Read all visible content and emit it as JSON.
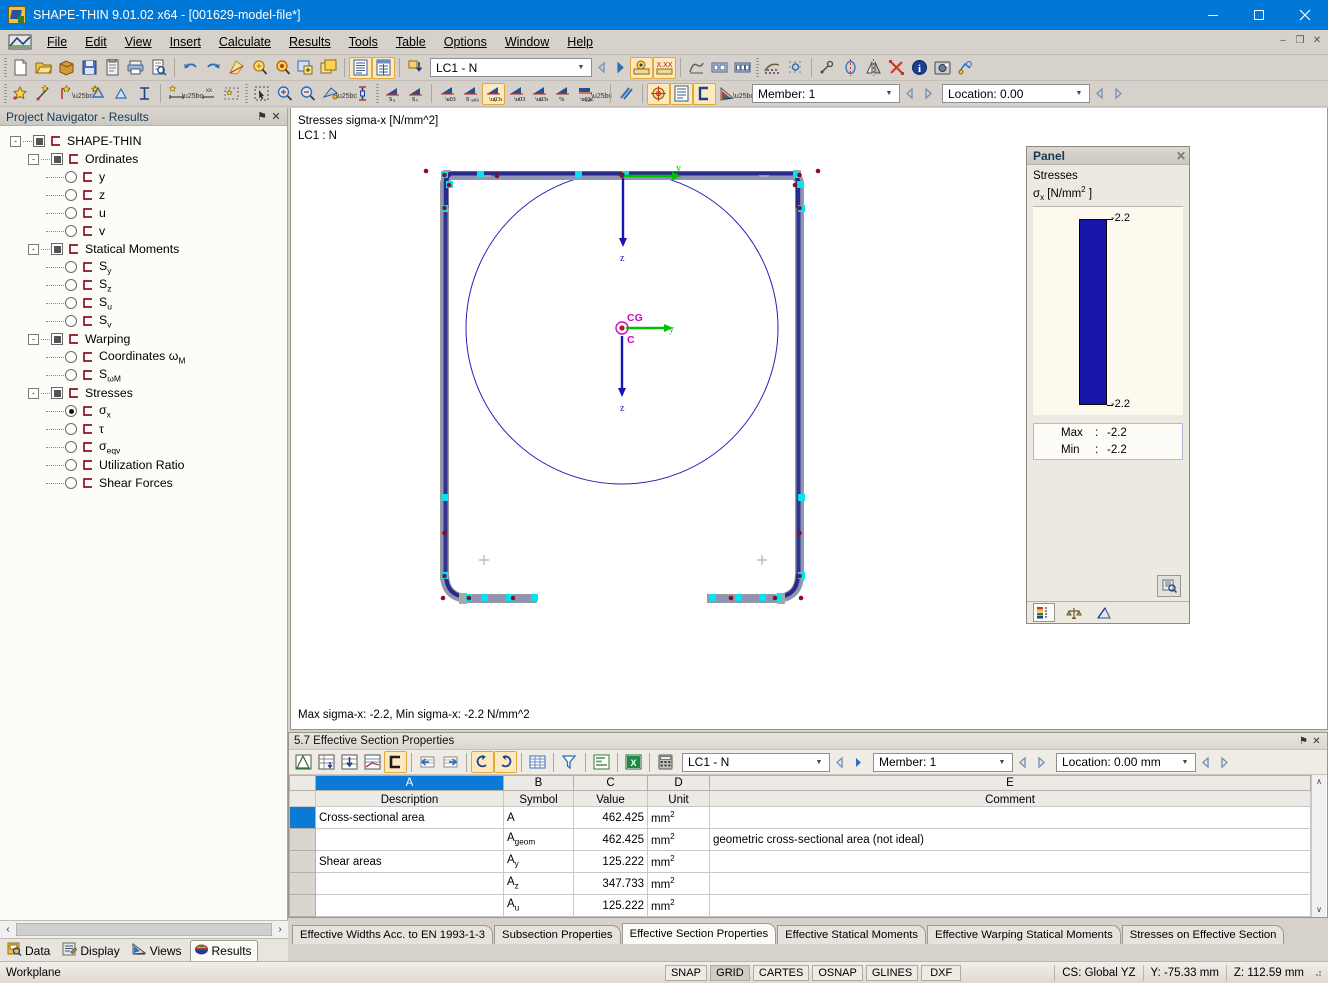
{
  "window": {
    "title": "SHAPE-THIN 9.01.02 x64 - [001629-model-file*]",
    "minimize": "–",
    "maximize": "□",
    "close": "✕"
  },
  "menubar": {
    "items": [
      {
        "label": "File"
      },
      {
        "label": "Edit"
      },
      {
        "label": "View"
      },
      {
        "label": "Insert"
      },
      {
        "label": "Calculate"
      },
      {
        "label": "Results"
      },
      {
        "label": "Tools"
      },
      {
        "label": "Table"
      },
      {
        "label": "Options"
      },
      {
        "label": "Window"
      },
      {
        "label": "Help"
      }
    ],
    "mdi_minimize": "–",
    "mdi_restore": "❐",
    "mdi_close": "✕"
  },
  "toolbar1": {
    "loadcase_value": "LC1 - N",
    "dropdown_arrow": "▼",
    "prev_arrow": "◁",
    "next_arrow": "▷"
  },
  "toolbar2": {
    "member_value": "Member: 1",
    "location_value": "Location: 0.00",
    "dropdown_arrow": "▼",
    "prev_arrow": "◁",
    "next_arrow": "▷"
  },
  "navigator": {
    "title": "Project Navigator - Results",
    "pin": "⚑",
    "close": "✕",
    "tree": [
      {
        "level": 0,
        "type": "check",
        "label": "SHAPE-THIN",
        "expander": "-",
        "checked": true
      },
      {
        "level": 1,
        "type": "check",
        "label": "Ordinates",
        "expander": "-",
        "checked": true
      },
      {
        "level": 2,
        "type": "radio",
        "label": "y",
        "selected": false
      },
      {
        "level": 2,
        "type": "radio",
        "label": "z",
        "selected": false
      },
      {
        "level": 2,
        "type": "radio",
        "label": "u",
        "selected": false
      },
      {
        "level": 2,
        "type": "radio",
        "label": "v",
        "selected": false
      },
      {
        "level": 1,
        "type": "check",
        "label": "Statical Moments",
        "expander": "-",
        "checked": true
      },
      {
        "level": 2,
        "type": "radio",
        "label": "S",
        "sub": "y",
        "selected": false
      },
      {
        "level": 2,
        "type": "radio",
        "label": "S",
        "sub": "z",
        "selected": false
      },
      {
        "level": 2,
        "type": "radio",
        "label": "S",
        "sub": "u",
        "selected": false
      },
      {
        "level": 2,
        "type": "radio",
        "label": "S",
        "sub": "v",
        "selected": false
      },
      {
        "level": 1,
        "type": "check",
        "label": "Warping",
        "expander": "-",
        "checked": true
      },
      {
        "level": 2,
        "type": "radio",
        "label": "Coordinates ω",
        "sub": "M",
        "selected": false
      },
      {
        "level": 2,
        "type": "radio",
        "label": "S",
        "sub": "ωM",
        "selected": false
      },
      {
        "level": 1,
        "type": "check",
        "label": "Stresses",
        "expander": "-",
        "checked": true
      },
      {
        "level": 2,
        "type": "radio",
        "label": "σ",
        "sub": "x",
        "selected": true
      },
      {
        "level": 2,
        "type": "radio",
        "label": "τ",
        "selected": false
      },
      {
        "level": 2,
        "type": "radio",
        "label": "σ",
        "sub": "eqv",
        "selected": false
      },
      {
        "level": 2,
        "type": "radio",
        "label": "Utilization Ratio",
        "selected": false
      },
      {
        "level": 2,
        "type": "radio",
        "label": "Shear Forces",
        "selected": false
      }
    ]
  },
  "drawing": {
    "caption_line1": "Stresses sigma-x [N/mm^2]",
    "caption_line2": "LC1 : N",
    "status_text": "Max sigma-x: -2.2, Min sigma-x: -2.2 N/mm^2",
    "axis_labels": {
      "top_y": "y",
      "top_z": "z",
      "cg": "CG",
      "c": "C",
      "center_y": "y",
      "center_z": "z"
    }
  },
  "panel": {
    "title": "Panel",
    "close": "✕",
    "heading": "Stresses",
    "quantity": "σ",
    "quantity_sub": "x",
    "unit": " [N/mm",
    "unit_sup": "2",
    "unit_end": " ]",
    "legend_top": "-2.2",
    "legend_bottom": "-2.2",
    "legend_color": "#1616a8",
    "max_label": "Max",
    "max_colon": ":",
    "max_value": "-2.2",
    "min_label": "Min",
    "min_colon": ":",
    "min_value": "-2.2"
  },
  "table_window": {
    "title": "5.7 Effective Section Properties",
    "pin": "⚑",
    "close": "✕",
    "loadcase_value": "LC1 - N",
    "member_value": "Member: 1",
    "location_value": "Location: 0.00 mm",
    "dropdown_arrow": "▼",
    "prev_arrow": "◁",
    "next_arrow": "▷",
    "column_letters": [
      "A",
      "B",
      "C",
      "D",
      "E"
    ],
    "headers": [
      "Description",
      "Symbol",
      "Value",
      "Unit",
      "Comment"
    ],
    "rows": [
      {
        "description": "Cross-sectional area",
        "symbol": "A",
        "symbol_sub": "",
        "value": "462.425",
        "unit": "mm",
        "unit_sup": "2",
        "comment": "",
        "selected": true
      },
      {
        "description": "",
        "symbol": "A",
        "symbol_sub": "geom",
        "value": "462.425",
        "unit": "mm",
        "unit_sup": "2",
        "comment": "geometric cross-sectional area (not ideal)",
        "selected": false
      },
      {
        "description": "Shear areas",
        "symbol": "A",
        "symbol_sub": "y",
        "value": "125.222",
        "unit": "mm",
        "unit_sup": "2",
        "comment": "",
        "selected": false
      },
      {
        "description": "",
        "symbol": "A",
        "symbol_sub": "z",
        "value": "347.733",
        "unit": "mm",
        "unit_sup": "2",
        "comment": "",
        "selected": false
      },
      {
        "description": "",
        "symbol": "A",
        "symbol_sub": "u",
        "value": "125.222",
        "unit": "mm",
        "unit_sup": "2",
        "comment": "",
        "selected": false
      }
    ],
    "scroll_up": "∧",
    "scroll_down": "∨"
  },
  "table_tabs": [
    {
      "label": "Effective Widths Acc. to EN 1993-1-3",
      "active": false
    },
    {
      "label": "Subsection Properties",
      "active": false
    },
    {
      "label": "Effective Section Properties",
      "active": true
    },
    {
      "label": "Effective Statical Moments",
      "active": false
    },
    {
      "label": "Effective Warping Statical Moments",
      "active": false
    },
    {
      "label": "Stresses on Effective Section",
      "active": false
    }
  ],
  "navigator_tabs": [
    {
      "label": "Data",
      "icon": "data-icon",
      "active": false
    },
    {
      "label": "Display",
      "icon": "display-icon",
      "active": false
    },
    {
      "label": "Views",
      "icon": "views-icon",
      "active": false
    },
    {
      "label": "Results",
      "icon": "results-icon",
      "active": true
    }
  ],
  "navigator_scroll": {
    "left": "‹",
    "right": "›"
  },
  "statusbar": {
    "workplane": "Workplane",
    "chips": [
      {
        "label": "SNAP",
        "on": false
      },
      {
        "label": "GRID",
        "on": true
      },
      {
        "label": "CARTES",
        "on": false
      },
      {
        "label": "OSNAP",
        "on": false
      },
      {
        "label": "GLINES",
        "on": false
      },
      {
        "label": "DXF",
        "on": false
      }
    ],
    "cs": "CS: Global YZ",
    "y_coord": "Y:  -75.33 mm",
    "z_coord": "Z:  112.59 mm"
  }
}
